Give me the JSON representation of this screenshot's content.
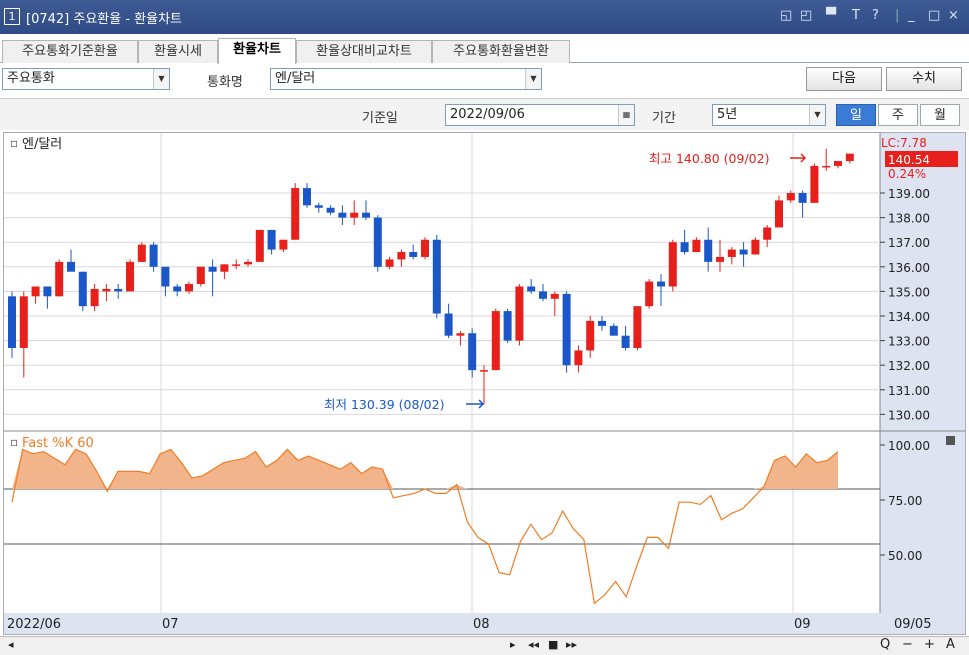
{
  "window": {
    "number": "1",
    "title": "[0742] 주요환율 - 환율차트",
    "controls": [
      "◱",
      "◰",
      "▀",
      "T",
      "?",
      "|",
      "_",
      "□",
      "×"
    ]
  },
  "tabs": [
    {
      "label": "주요통화기준환율"
    },
    {
      "label": "환율시세"
    },
    {
      "label": "환율차트"
    },
    {
      "label": "환율상대비교차트"
    },
    {
      "label": "주요통화환율변환"
    }
  ],
  "toolbar": {
    "group_select": "주요통화",
    "currency_label": "통화명",
    "currency_select": "엔/달러",
    "next_button": "다음",
    "numeric_button": "수치",
    "base_date_label": "기준일",
    "base_date": "2022/09/06",
    "period_label": "기간",
    "period_select": "5년",
    "periods": [
      "일",
      "주",
      "월"
    ]
  },
  "colors": {
    "up": "#e8201c",
    "down": "#1c57c9",
    "stoch_fill": "#f2b48a",
    "stoch_line": "#f07d24"
  },
  "chart_data": [
    {
      "type": "candlestick",
      "title": "엔/달러",
      "ylim": [
        129.6,
        143.0
      ],
      "yticks": [
        "139.00",
        "138.00",
        "137.00",
        "136.00",
        "135.00",
        "134.00",
        "133.00",
        "132.00",
        "131.00",
        "130.00"
      ],
      "last_label": "LC:7.78",
      "last_price": "140.54",
      "last_change": "0.24%",
      "high_annotation": "최고 140.80 (09/02)",
      "low_annotation": "최저 130.39 (08/02)",
      "candles": [
        [
          134.8,
          135.0,
          132.3,
          132.7
        ],
        [
          132.7,
          135.0,
          131.5,
          134.8
        ],
        [
          134.8,
          135.2,
          134.5,
          135.2
        ],
        [
          135.2,
          135.2,
          134.3,
          134.8
        ],
        [
          134.8,
          136.3,
          134.8,
          136.2
        ],
        [
          136.2,
          136.7,
          136.0,
          135.8
        ],
        [
          135.8,
          135.8,
          134.2,
          134.4
        ],
        [
          134.4,
          135.3,
          134.2,
          135.1
        ],
        [
          135.0,
          135.3,
          134.6,
          135.1
        ],
        [
          135.1,
          135.3,
          134.7,
          135.0
        ],
        [
          135.0,
          136.3,
          135.0,
          136.2
        ],
        [
          136.2,
          137.0,
          136.2,
          136.9
        ],
        [
          136.9,
          137.0,
          135.8,
          136.0
        ],
        [
          136.0,
          136.0,
          134.8,
          135.2
        ],
        [
          135.2,
          135.3,
          134.8,
          135.0
        ],
        [
          135.0,
          135.4,
          134.9,
          135.3
        ],
        [
          135.3,
          136.0,
          135.2,
          136.0
        ],
        [
          136.0,
          136.3,
          134.8,
          135.8
        ],
        [
          135.8,
          136.1,
          135.5,
          136.1
        ],
        [
          136.1,
          136.3,
          135.9,
          136.1
        ],
        [
          136.1,
          136.3,
          136.0,
          136.2
        ],
        [
          136.2,
          137.5,
          136.2,
          137.5
        ],
        [
          137.5,
          137.5,
          136.5,
          136.7
        ],
        [
          136.7,
          137.1,
          136.6,
          137.1
        ],
        [
          137.1,
          139.4,
          137.1,
          139.2
        ],
        [
          139.2,
          139.4,
          138.4,
          138.5
        ],
        [
          138.5,
          138.6,
          138.2,
          138.4
        ],
        [
          138.4,
          138.5,
          138.1,
          138.2
        ],
        [
          138.2,
          138.5,
          137.7,
          138.0
        ],
        [
          138.0,
          138.7,
          137.7,
          138.2
        ],
        [
          138.2,
          138.7,
          137.9,
          138.0
        ],
        [
          138.0,
          138.1,
          135.8,
          136.0
        ],
        [
          136.0,
          136.4,
          135.9,
          136.3
        ],
        [
          136.3,
          136.7,
          136.0,
          136.6
        ],
        [
          136.6,
          136.9,
          136.3,
          136.4
        ],
        [
          136.4,
          137.2,
          136.3,
          137.1
        ],
        [
          137.1,
          137.3,
          133.9,
          134.1
        ],
        [
          134.1,
          134.5,
          133.1,
          133.2
        ],
        [
          133.2,
          133.4,
          132.8,
          133.3
        ],
        [
          133.3,
          133.5,
          131.5,
          131.8
        ],
        [
          131.8,
          132.0,
          130.4,
          131.8
        ],
        [
          131.8,
          134.3,
          131.8,
          134.2
        ],
        [
          134.2,
          134.3,
          132.9,
          133.0
        ],
        [
          133.0,
          135.3,
          132.8,
          135.2
        ],
        [
          135.2,
          135.5,
          134.9,
          135.0
        ],
        [
          135.0,
          135.3,
          134.6,
          134.7
        ],
        [
          134.7,
          135.0,
          134.0,
          134.9
        ],
        [
          134.9,
          135.0,
          131.7,
          132.0
        ],
        [
          132.0,
          132.8,
          131.7,
          132.6
        ],
        [
          132.6,
          134.0,
          132.3,
          133.8
        ],
        [
          133.8,
          134.0,
          133.4,
          133.6
        ],
        [
          133.6,
          133.7,
          133.2,
          133.2
        ],
        [
          133.2,
          133.6,
          132.6,
          132.7
        ],
        [
          132.7,
          134.4,
          132.6,
          134.4
        ],
        [
          134.4,
          135.5,
          134.3,
          135.4
        ],
        [
          135.4,
          135.7,
          134.4,
          135.2
        ],
        [
          135.2,
          137.1,
          135.0,
          137.0
        ],
        [
          137.0,
          137.5,
          136.5,
          136.6
        ],
        [
          136.6,
          137.2,
          136.6,
          137.1
        ],
        [
          137.1,
          137.6,
          135.8,
          136.2
        ],
        [
          136.2,
          137.1,
          135.8,
          136.4
        ],
        [
          136.4,
          136.8,
          136.1,
          136.7
        ],
        [
          136.7,
          137.0,
          136.0,
          136.5
        ],
        [
          136.5,
          137.2,
          136.5,
          137.1
        ],
        [
          137.1,
          137.7,
          136.8,
          137.6
        ],
        [
          137.6,
          138.9,
          137.6,
          138.7
        ],
        [
          138.7,
          139.1,
          138.6,
          139.0
        ],
        [
          139.0,
          139.1,
          138.0,
          138.6
        ],
        [
          138.6,
          140.2,
          138.6,
          140.1
        ],
        [
          140.1,
          140.8,
          139.9,
          140.1
        ],
        [
          140.1,
          140.3,
          140.0,
          140.3
        ],
        [
          140.3,
          140.6,
          140.2,
          140.6
        ]
      ],
      "x_labels": [
        "2022/06",
        "07",
        "08",
        "09",
        "09/05"
      ]
    },
    {
      "type": "area",
      "title": "Fast %K 60",
      "ylim": [
        45,
        100
      ],
      "yticks": [
        "100.00",
        "75.00",
        "50.00"
      ],
      "reference_lines": [
        80,
        55
      ],
      "values": [
        74,
        98,
        96,
        97,
        94,
        91,
        98,
        96,
        88,
        79,
        88,
        88,
        88,
        87,
        96,
        98,
        92,
        85,
        86,
        89,
        92,
        93,
        94,
        97,
        90,
        93,
        98,
        93,
        95,
        93,
        91,
        89,
        92,
        87,
        90,
        89,
        76,
        77,
        78,
        80,
        78,
        78,
        82,
        65,
        58,
        55,
        42,
        41,
        56,
        64,
        57,
        60,
        70,
        62,
        57,
        28,
        32,
        38,
        31,
        45,
        58,
        58,
        53,
        74,
        74,
        73,
        77,
        66,
        69,
        71,
        76,
        81,
        93,
        95,
        90,
        96,
        92,
        93,
        97
      ]
    }
  ]
}
